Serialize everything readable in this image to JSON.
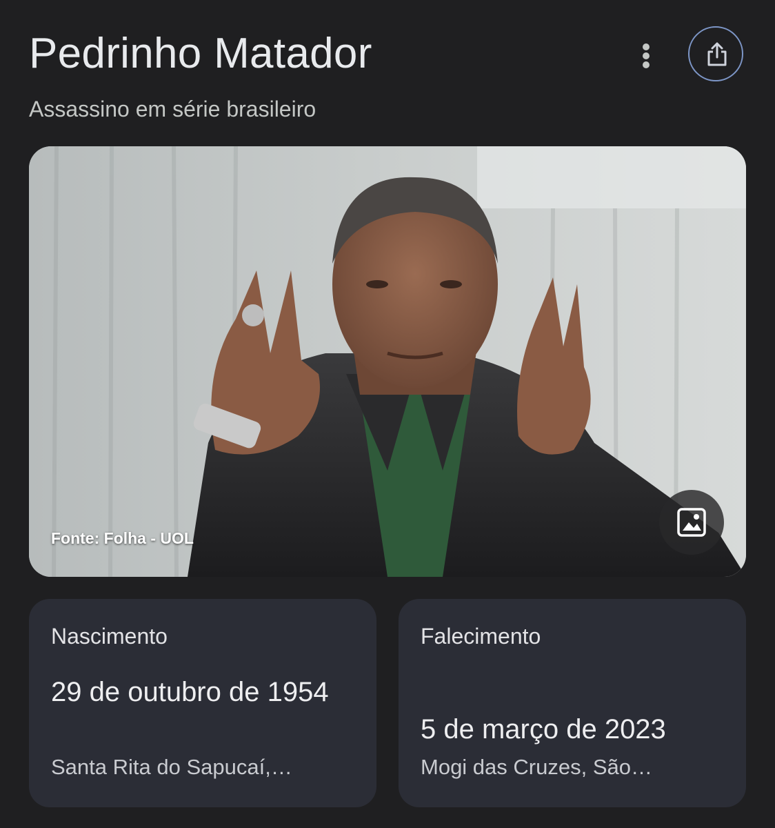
{
  "header": {
    "title": "Pedrinho Matador",
    "subtitle": "Assassino em série brasileiro",
    "more_icon": "more-vert-icon",
    "share_icon": "share-icon"
  },
  "photo": {
    "source_caption": "Fonte: Folha - UOL",
    "gallery_icon": "image-gallery-icon"
  },
  "facts": {
    "birth": {
      "label": "Nascimento",
      "date": "29 de outubro de 1954",
      "place": "Santa Rita do Sapucaí,…"
    },
    "death": {
      "label": "Falecimento",
      "date": "5 de março de 2023",
      "place": "Mogi das Cruzes, São…"
    }
  },
  "colors": {
    "background": "#1f1f21",
    "card": "#2b2d36",
    "share_ring": "#7d96c7"
  }
}
